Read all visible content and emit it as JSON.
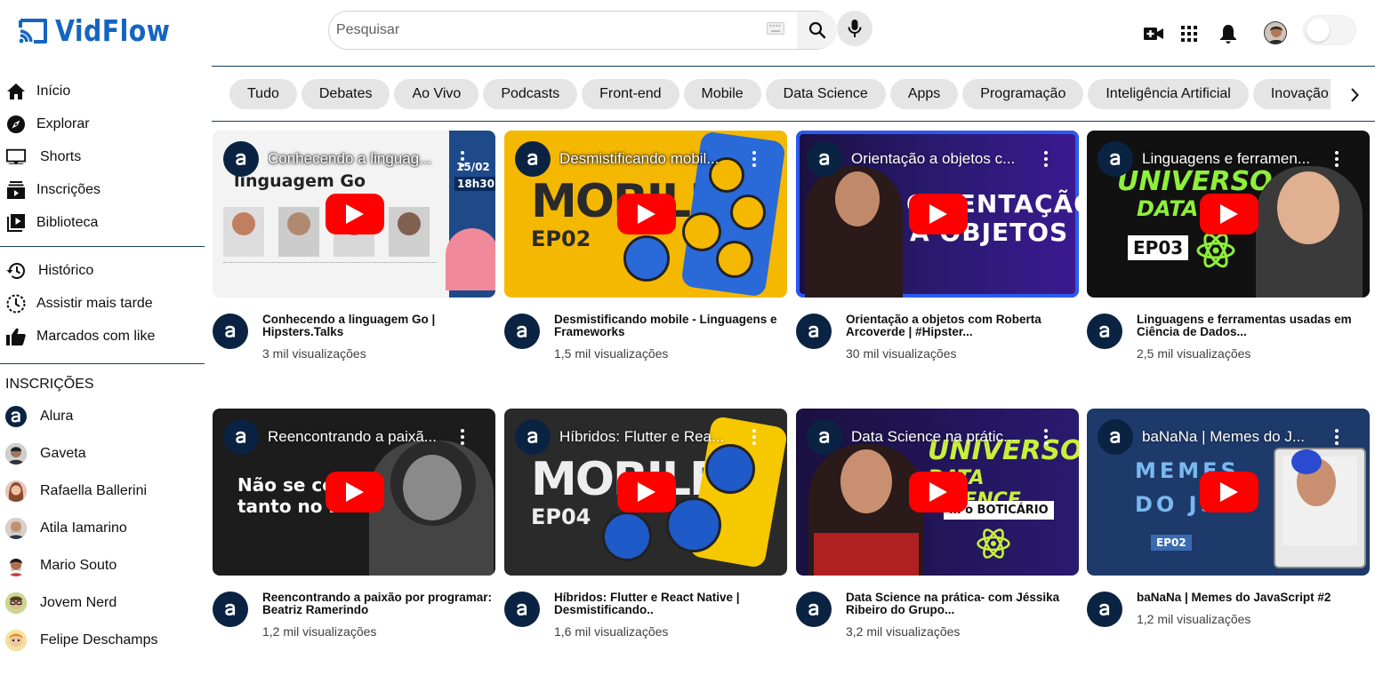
{
  "app": {
    "name": "VidFlow",
    "brand_color": "#1565c0"
  },
  "search": {
    "placeholder": "Pesquisar"
  },
  "header_icons": [
    "create-video-icon",
    "apps-icon",
    "notifications-icon",
    "account-avatar",
    "theme-toggle"
  ],
  "sidebar": {
    "main": [
      {
        "label": "Início",
        "icon": "home-icon"
      },
      {
        "label": "Explorar",
        "icon": "compass-icon"
      },
      {
        "label": "Shorts",
        "icon": "shorts-icon"
      },
      {
        "label": "Inscrições",
        "icon": "subscriptions-icon"
      },
      {
        "label": "Biblioteca",
        "icon": "library-icon"
      }
    ],
    "secondary": [
      {
        "label": "Histórico",
        "icon": "history-icon"
      },
      {
        "label": "Assistir mais tarde",
        "icon": "clock-icon"
      },
      {
        "label": "Marcados com like",
        "icon": "thumbs-up-icon"
      }
    ],
    "subscriptions_heading": "INSCRIÇÕES",
    "subscriptions": [
      {
        "label": "Alura",
        "color": "#0a2342"
      },
      {
        "label": "Gaveta",
        "color": "#6b5a4a"
      },
      {
        "label": "Rafaella Ballerini",
        "color": "#c98a6a"
      },
      {
        "label": "Atila Iamarino",
        "color": "#7a6a5a"
      },
      {
        "label": "Mario Souto",
        "color": "#3a3a3a"
      },
      {
        "label": "Jovem Nerd",
        "color": "#9aa85a"
      },
      {
        "label": "Felipe Deschamps",
        "color": "#e0b040"
      }
    ]
  },
  "chips": [
    "Tudo",
    "Debates",
    "Ao Vivo",
    "Podcasts",
    "Front-end",
    "Mobile",
    "Data Science",
    "Apps",
    "Programação",
    "Inteligência Artificial",
    "Inovação"
  ],
  "videos": [
    {
      "overlay_title": "Conhecendo a linguag...",
      "title": "Conhecendo a linguagem Go | Hipsters.Talks",
      "views": "3 mil visualizações",
      "thumb_text": [
        "linguagem Go",
        "15/02",
        "18h30"
      ]
    },
    {
      "overlay_title": "Desmistificando mobil...",
      "title": "Desmistificando mobile - Linguagens e Frameworks",
      "views": "1,5 mil visualizações",
      "thumb_text": [
        "MOBILE",
        "EP02"
      ]
    },
    {
      "overlay_title": "Orientação a objetos c...",
      "title": "Orientação a objetos com Roberta Arcoverde | #Hipster...",
      "views": "30 mil visualizações",
      "thumb_text": [
        "ORIENTAÇÃO",
        "A OBJETOS"
      ]
    },
    {
      "overlay_title": "Linguagens e ferramen...",
      "title": "Linguagens e ferramentas usadas em Ciência de Dados...",
      "views": "2,5 mil visualizações",
      "thumb_text": [
        "UNIVERSO",
        "DATA SC",
        "EP03"
      ]
    },
    {
      "overlay_title": "Reencontrando a paixã...",
      "title": "Reencontrando a paixão por programar: Beatriz Ramerindo",
      "views": "1,2 mil visualizações",
      "thumb_text": [
        "Não se co",
        "tanto no i"
      ]
    },
    {
      "overlay_title": "Híbridos: Flutter e Rea...",
      "title": "Híbridos: Flutter e React Native | Desmistificando..",
      "views": "1,6 mil visualizações",
      "thumb_text": [
        "MOBILE",
        "EP04"
      ]
    },
    {
      "overlay_title": "Data Science na prátic...",
      "title": "Data Science na prática- com Jéssika Ribeiro do Grupo...",
      "views": "3,2 mil visualizações",
      "thumb_text": [
        "UNIVERSO",
        "DATA SCIENCE",
        "m o BOTICÁRIO"
      ]
    },
    {
      "overlay_title": "baNaNa | Memes do J...",
      "title": "baNaNa | Memes do JavaScript #2",
      "views": "1,2 mil visualizações",
      "thumb_text": [
        "MEMES",
        "DO JS",
        "EP02"
      ]
    }
  ]
}
